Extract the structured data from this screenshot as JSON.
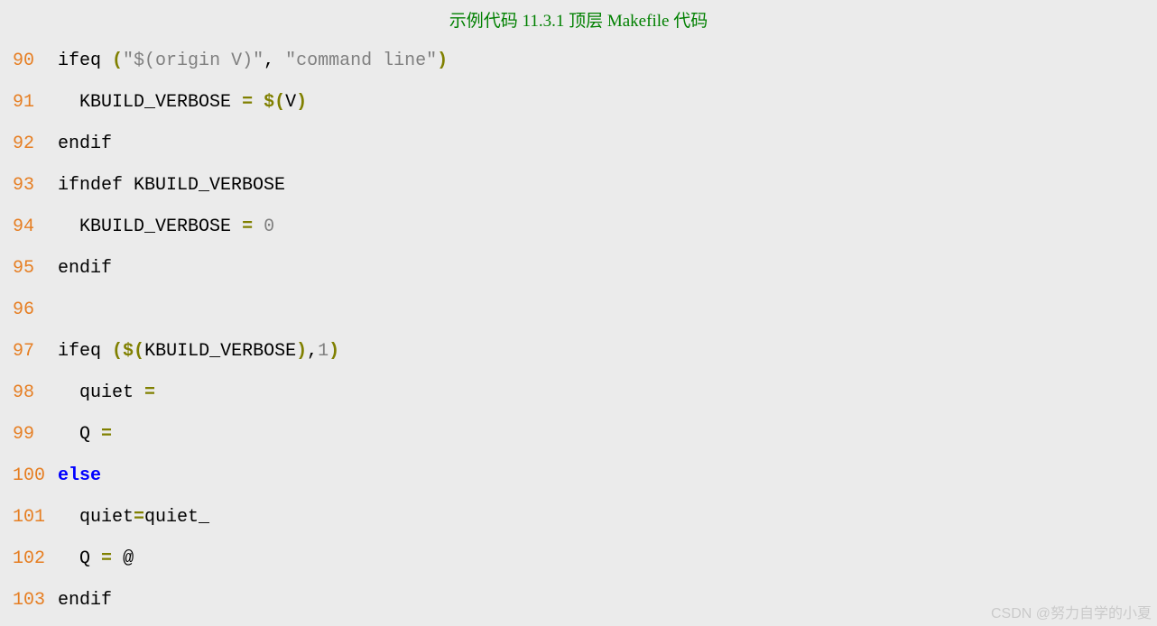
{
  "title_cn_prefix": "示例代码 ",
  "title_version": "11.3.1",
  "title_cn_mid": "  顶层 ",
  "title_latin": "Makefile",
  "title_cn_suffix": " 代码",
  "lines": {
    "90": {
      "ln": "90",
      "ifeq": "ifeq",
      "lp": "(",
      "s1": "\"$(origin V)\"",
      "comma": ",",
      "sp": " ",
      "s2": "\"command line\"",
      "rp": ")"
    },
    "91": {
      "ln": "91",
      "ind": "  ",
      "name": "KBUILD_VERBOSE",
      "sp1": " ",
      "eq": "=",
      "sp2": " ",
      "dol": "$(",
      "v": "V",
      "rp": ")"
    },
    "92": {
      "ln": "92",
      "endif": "endif"
    },
    "93": {
      "ln": "93",
      "ifndef": "ifndef",
      "sp": " ",
      "name": "KBUILD_VERBOSE"
    },
    "94": {
      "ln": "94",
      "ind": "  ",
      "name": "KBUILD_VERBOSE",
      "sp1": " ",
      "eq": "=",
      "sp2": " ",
      "val": "0"
    },
    "95": {
      "ln": "95",
      "endif": "endif"
    },
    "96": {
      "ln": "96"
    },
    "97": {
      "ln": "97",
      "ifeq": "ifeq",
      "sp": " ",
      "lp": "(",
      "dol": "$(",
      "name": "KBUILD_VERBOSE",
      "drp": ")",
      "comma": ",",
      "one": "1",
      "rp": ")"
    },
    "98": {
      "ln": "98",
      "ind": "  ",
      "name": "quiet",
      "sp": " ",
      "eq": "="
    },
    "99": {
      "ln": "99",
      "ind": "  ",
      "name": "Q",
      "sp": " ",
      "eq": "="
    },
    "100": {
      "ln": "100",
      "else": "else"
    },
    "101": {
      "ln": "101",
      "ind": "  ",
      "name": "quiet",
      "eq": "=",
      "val": "quiet_"
    },
    "102": {
      "ln": "102",
      "ind": "  ",
      "name": "Q",
      "sp1": " ",
      "eq": "=",
      "sp2": " ",
      "val": "@"
    },
    "103": {
      "ln": "103",
      "endif": "endif"
    }
  },
  "watermark": "CSDN @努力自学的小夏"
}
